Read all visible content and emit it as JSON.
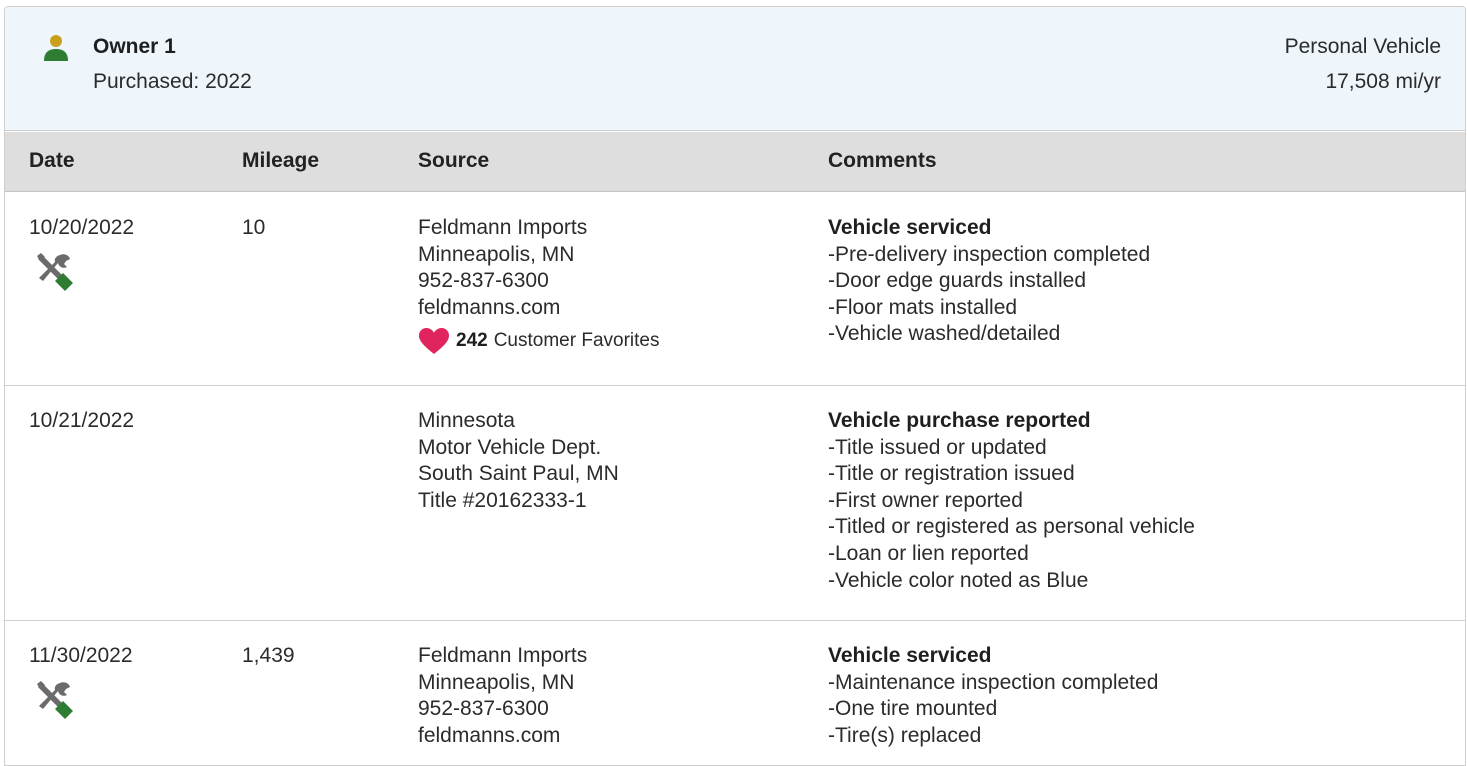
{
  "owner": {
    "name": "Owner 1",
    "purchased": "Purchased: 2022",
    "use": "Personal Vehicle",
    "miles_per_year": "17,508 mi/yr",
    "icon": "person-icon"
  },
  "table": {
    "headers": {
      "date": "Date",
      "mileage": "Mileage",
      "source": "Source",
      "comments": "Comments"
    },
    "rows": [
      {
        "date": "10/20/2022",
        "mileage": "10",
        "icon": "service-tools-icon",
        "source": [
          "Feldmann Imports",
          "Minneapolis, MN",
          "952-837-6300",
          "feldmanns.com"
        ],
        "favorites_count": "242",
        "favorites_label": "Customer Favorites",
        "comment_title": "Vehicle serviced",
        "comment_items": [
          "Pre-delivery inspection completed",
          "Door edge guards installed",
          "Floor mats installed",
          "Vehicle washed/detailed"
        ]
      },
      {
        "date": "10/21/2022",
        "mileage": "",
        "source": [
          "Minnesota",
          "Motor Vehicle Dept.",
          "South Saint Paul, MN",
          "Title #20162333-1"
        ],
        "comment_title": "Vehicle purchase reported",
        "comment_items": [
          "Title issued or updated",
          "Title or registration issued",
          "First owner reported",
          "Titled or registered as personal vehicle",
          "Loan or lien reported",
          "Vehicle color noted as Blue"
        ]
      },
      {
        "date": "11/30/2022",
        "mileage": "1,439",
        "icon": "service-tools-icon",
        "source": [
          "Feldmann Imports",
          "Minneapolis, MN",
          "952-837-6300",
          "feldmanns.com"
        ],
        "comment_title": "Vehicle serviced",
        "comment_items": [
          "Maintenance inspection completed",
          "One tire mounted",
          "Tire(s) replaced"
        ]
      }
    ]
  },
  "colors": {
    "header_bg": "#eef5fb",
    "table_head_bg": "#dedede",
    "accent_green": "#2e7d32",
    "owner_icon_gold": "#c8a019",
    "heart": "#e0245e"
  }
}
